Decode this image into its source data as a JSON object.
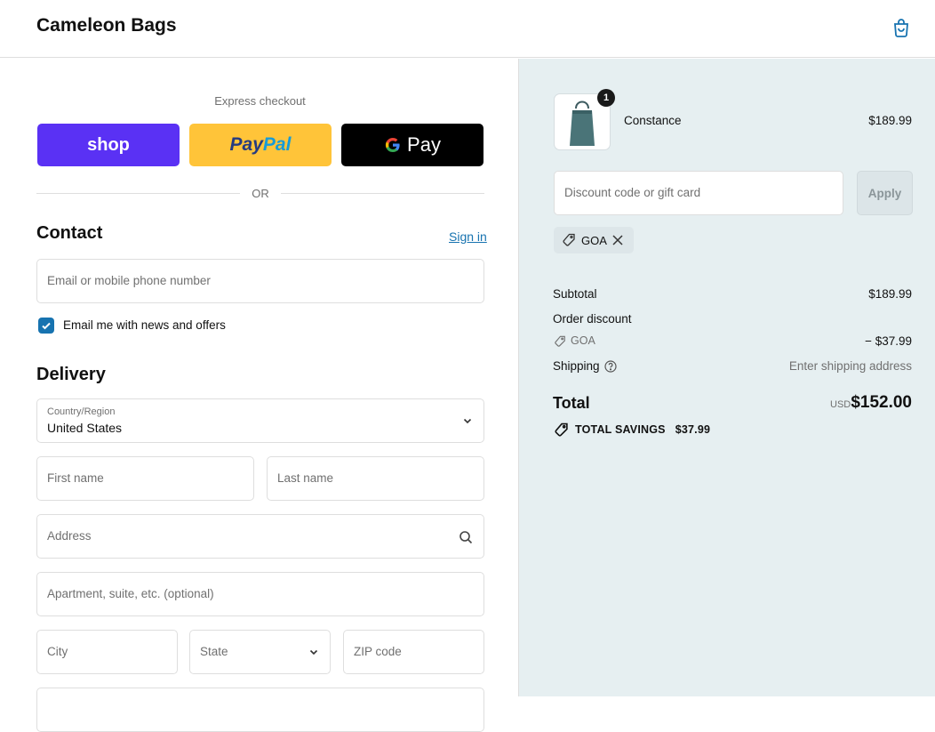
{
  "header": {
    "brand": "Cameleon Bags",
    "cart_icon": "shopping-bag-icon"
  },
  "express": {
    "label": "Express checkout",
    "shop_label": "shop",
    "paypal_label_1": "Pay",
    "paypal_label_2": "Pal",
    "gpay_label": "Pay",
    "or_label": "OR"
  },
  "contact": {
    "title": "Contact",
    "sign_in": "Sign in",
    "email_placeholder": "Email or mobile phone number",
    "newsletter_label": "Email me with news and offers",
    "newsletter_checked": true
  },
  "delivery": {
    "title": "Delivery",
    "country_label": "Country/Region",
    "country_value": "United States",
    "first_name_placeholder": "First name",
    "last_name_placeholder": "Last name",
    "address_placeholder": "Address",
    "apartment_placeholder": "Apartment, suite, etc. (optional)",
    "city_placeholder": "City",
    "state_placeholder": "State",
    "zip_placeholder": "ZIP code"
  },
  "summary": {
    "product": {
      "name": "Constance",
      "price": "$189.99",
      "quantity": "1"
    },
    "discount_placeholder": "Discount code or gift card",
    "apply_label": "Apply",
    "applied_code": "GOA",
    "subtotal_label": "Subtotal",
    "subtotal_value": "$189.99",
    "order_discount_label": "Order discount",
    "discount_code": "GOA",
    "discount_value": "− $37.99",
    "shipping_label": "Shipping",
    "shipping_value": "Enter shipping address",
    "total_label": "Total",
    "currency": "USD",
    "total_value": "$152.00",
    "savings_label": "TOTAL SAVINGS",
    "savings_value": "$37.99"
  },
  "colors": {
    "accent": "#1773b0",
    "shop": "#5a31f4",
    "paypal": "#ffc439",
    "gpay": "#000000",
    "summary_bg": "#e6eff1"
  }
}
